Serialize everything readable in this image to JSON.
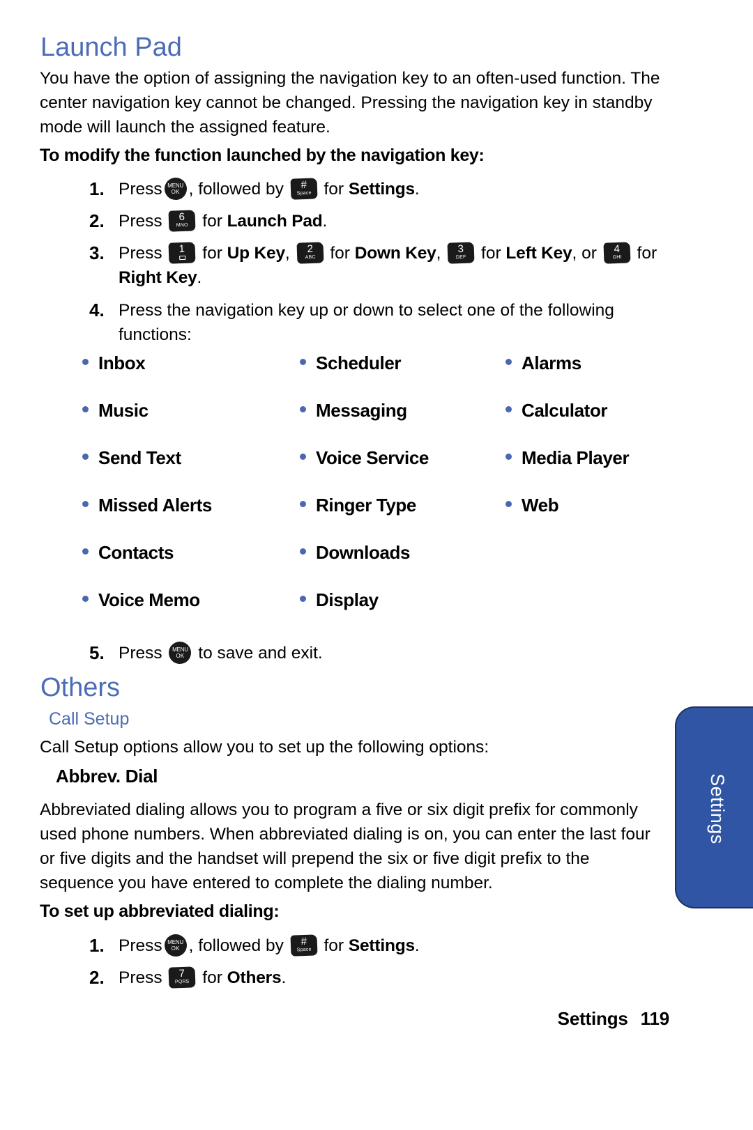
{
  "page": {
    "title": "Launch Pad",
    "intro": "You have the option of assigning the navigation key to an often-used function. The center navigation key cannot be changed. Pressing the navigation key in standby mode will launch the assigned feature."
  },
  "launch_pad": {
    "procedure_title": "To modify the function launched by the navigation key:",
    "steps": {
      "s1": {
        "num": "1.",
        "press": "Press",
        "mid": ", followed by",
        "tail_for": "for",
        "target": "Settings",
        "period": "."
      },
      "s2": {
        "num": "2.",
        "press": "Press",
        "tail_for": "for",
        "target": "Launch Pad",
        "period": "."
      },
      "s3": {
        "num": "3.",
        "press": "Press",
        "for1": "for",
        "target1": "Up Key",
        "comma1": ",",
        "for2": "for",
        "target2": "Down Key",
        "comma2": ",",
        "for3": "for",
        "target3": "Left Key",
        "or": ", or",
        "for4": "for",
        "target4": "Right Key",
        "period": "."
      },
      "s4": {
        "num": "4.",
        "text": "Press the navigation key up or down to select one of the following functions:"
      },
      "s5": {
        "num": "5.",
        "press": "Press",
        "tail": "to save and exit."
      }
    },
    "keys": {
      "menu_ok": {
        "digit": "MENU",
        "sub": "OK",
        "name": "menu-ok-key"
      },
      "pound": {
        "digit": "#",
        "sub": "Space",
        "name": "pound-space-key"
      },
      "k1": {
        "digit": "1",
        "sub": "",
        "name": "number-1-key"
      },
      "k2": {
        "digit": "2",
        "sub": "ABC",
        "name": "number-2-key"
      },
      "k3": {
        "digit": "3",
        "sub": "DEF",
        "name": "number-3-key"
      },
      "k4": {
        "digit": "4",
        "sub": "GHI",
        "name": "number-4-key"
      },
      "k6": {
        "digit": "6",
        "sub": "MNO",
        "name": "number-6-key"
      },
      "k7": {
        "digit": "7",
        "sub": "PQRS",
        "name": "number-7-key"
      }
    },
    "functions": [
      [
        "Inbox",
        "Scheduler",
        "Alarms"
      ],
      [
        "Music",
        "Messaging",
        "Calculator"
      ],
      [
        "Send Text",
        "Voice Service",
        "Media Player"
      ],
      [
        "Missed Alerts",
        "Ringer Type",
        "Web"
      ],
      [
        "Contacts",
        "Downloads",
        ""
      ],
      [
        "Voice Memo",
        "Display",
        ""
      ]
    ]
  },
  "others": {
    "title": "Others",
    "call_setup_title": "Call Setup",
    "call_setup_intro": "Call Setup options allow you to set up the following options:",
    "abbrev_dial_title": "Abbrev. Dial",
    "abbrev_dial_body": "Abbreviated dialing allows you to program a five or six digit prefix for commonly used phone numbers. When abbreviated dialing is on, you can enter the last four or five digits and the handset will prepend the six or five digit prefix to the sequence you have entered to complete the dialing number.",
    "procedure_title": "To set up abbreviated dialing:",
    "steps": {
      "s1": {
        "num": "1.",
        "press": "Press",
        "mid": ", followed by",
        "tail_for": "for",
        "target": "Settings",
        "period": "."
      },
      "s2": {
        "num": "2.",
        "press": "Press",
        "tail_for": "for",
        "target": "Others",
        "period": "."
      }
    }
  },
  "side_tab": {
    "label": "Settings"
  },
  "footer": {
    "section": "Settings",
    "page_number": "119"
  },
  "colors": {
    "heading_blue": "#4b6cb7",
    "bullet_blue": "#4a68b0",
    "tab_blue": "#2f55a4",
    "text_black": "#000000"
  }
}
